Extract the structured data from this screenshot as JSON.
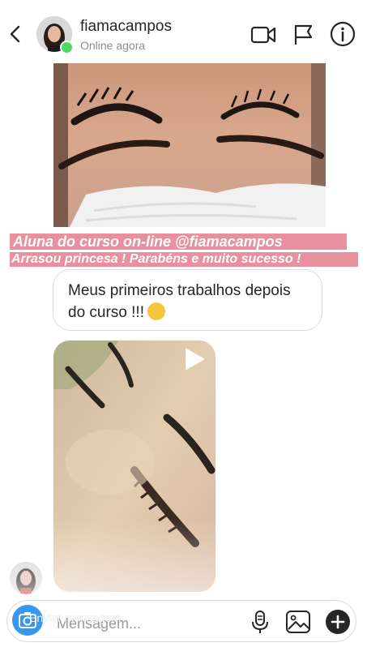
{
  "header": {
    "username": "fiamacampos",
    "status": "Online agora"
  },
  "story": {
    "caption_line1": "Aluna do curso on-line @fiamacampos",
    "caption_line2": "Arrasou princesa ! Parabéns e muito sucesso !"
  },
  "message": {
    "line1": "Meus primeiros trabalhos depois",
    "line2": "do curso !!!"
  },
  "composer": {
    "overlay_text": "Enviar mensagem",
    "placeholder": "Mensagem..."
  },
  "colors": {
    "caption_bg": "#e88fa0",
    "online": "#4cd964",
    "camera_button": "#3897f0"
  },
  "icons": [
    "back-icon",
    "video-call-icon",
    "flag-icon",
    "info-icon",
    "play-icon",
    "camera-icon",
    "microphone-icon",
    "gallery-icon",
    "plus-icon"
  ]
}
